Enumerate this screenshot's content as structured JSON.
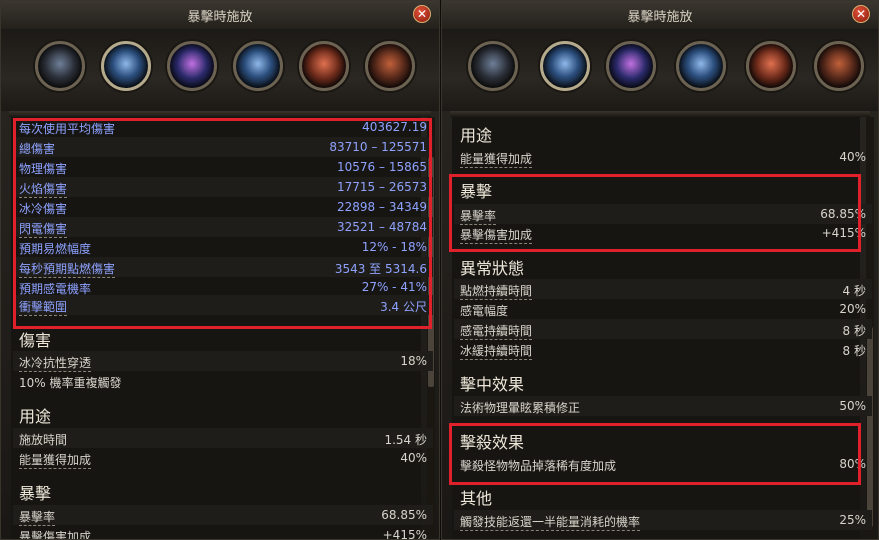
{
  "left": {
    "title": "暴擊時施放",
    "close_symbol": "✕",
    "stats_top": [
      {
        "label": "每次使用平均傷害",
        "value": "403627.19"
      },
      {
        "label": "總傷害",
        "value": "83710 – 125571"
      },
      {
        "label": "物理傷害",
        "value": "10576 – 15865"
      },
      {
        "label": "火焰傷害",
        "value": "17715 – 26573"
      },
      {
        "label": "冰冷傷害",
        "value": "22898 – 34349"
      },
      {
        "label": "閃電傷害",
        "value": "32521 – 48784"
      },
      {
        "label": "預期易燃幅度",
        "value": "12% - 18%"
      },
      {
        "label": "每秒預期點燃傷害",
        "value": "3543 至 5314.6"
      },
      {
        "label": "預期感電機率",
        "value": "27% - 41%"
      },
      {
        "label": "衝擊範圍",
        "value": "3.4 公尺"
      }
    ],
    "damage_heading": "傷害",
    "damage_rows": [
      {
        "label": "冰冷抗性穿透",
        "value": "18%"
      },
      {
        "label": "10% 機率重複觸發",
        "value": ""
      }
    ],
    "use_heading": "用途",
    "use_rows": [
      {
        "label": "施放時間",
        "value": "1.54 秒"
      },
      {
        "label": "能量獲得加成",
        "value": "40%"
      }
    ],
    "crit_heading": "暴擊",
    "crit_rows": [
      {
        "label": "暴擊率",
        "value": "68.85%"
      },
      {
        "label": "暴擊傷害加成",
        "value": "+415%"
      }
    ]
  },
  "right": {
    "title": "暴擊時施放",
    "close_symbol": "✕",
    "use_heading": "用途",
    "use_rows": [
      {
        "label": "能量獲得加成",
        "value": "40%"
      }
    ],
    "crit_heading": "暴擊",
    "crit_rows": [
      {
        "label": "暴擊率",
        "value": "68.85%"
      },
      {
        "label": "暴擊傷害加成",
        "value": "+415%"
      }
    ],
    "ailment_heading": "異常狀態",
    "ailment_rows": [
      {
        "label": "點燃持續時間",
        "value": "4 秒"
      },
      {
        "label": "感電幅度",
        "value": "20%"
      },
      {
        "label": "感電持續時間",
        "value": "8 秒"
      },
      {
        "label": "冰緩持續時間",
        "value": "8 秒"
      }
    ],
    "onhit_heading": "擊中效果",
    "onhit_rows": [
      {
        "label": "法術物理暈眩累積修正",
        "value": "50%"
      }
    ],
    "onkill_heading": "擊殺效果",
    "onkill_rows": [
      {
        "label": "擊殺怪物物品掉落稀有度加成",
        "value": "80%"
      }
    ],
    "other_heading": "其他",
    "other_rows": [
      {
        "label": "觸發技能返還一半能量消耗的機率",
        "value": "25%"
      }
    ]
  },
  "icons": [
    "gem-socket-icon",
    "orb-icon",
    "frost-orb-icon",
    "arcane-sphere-icon",
    "flame-scroll-icon",
    "tome-icon"
  ],
  "colors": {
    "highlight": "#e0202a",
    "stat_blue": "#8ea2ff",
    "text": "#d8d4cc"
  }
}
